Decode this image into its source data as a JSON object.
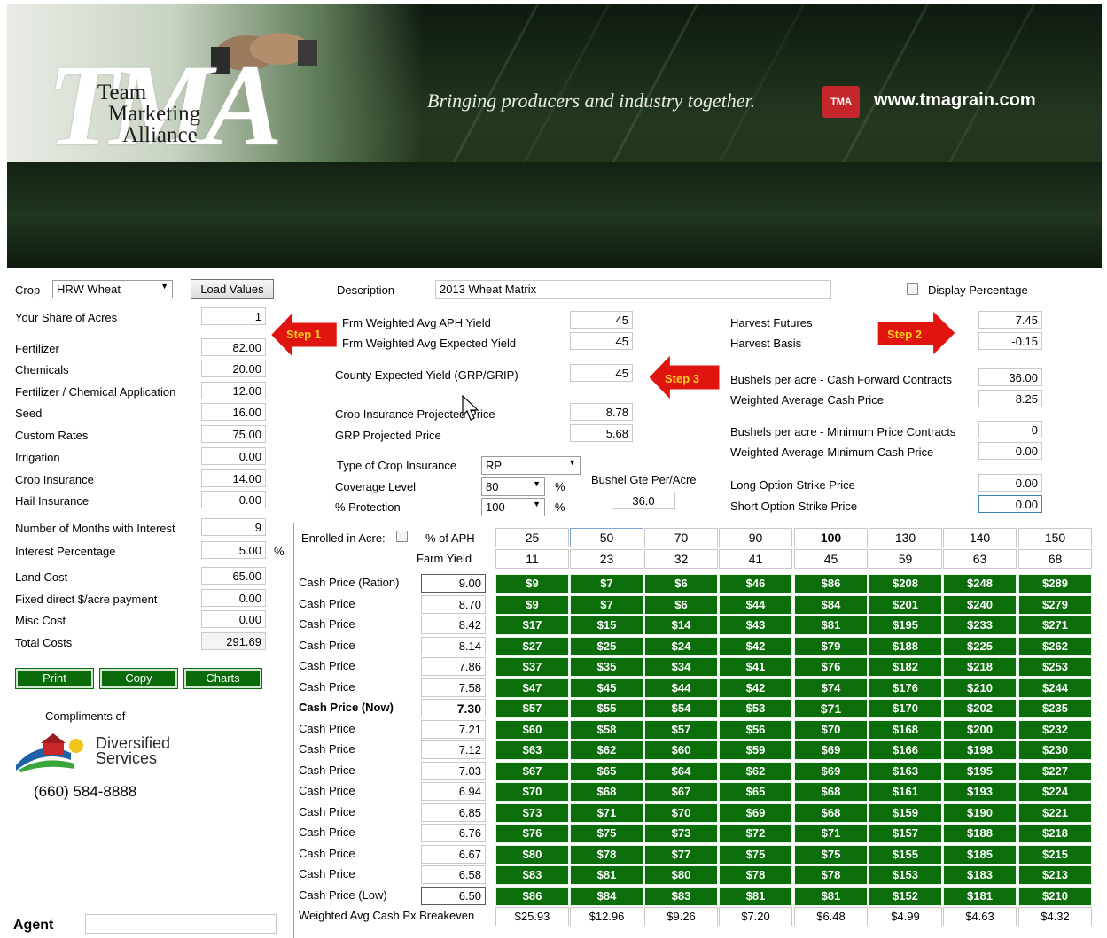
{
  "header": {
    "logo_letters": "TMA",
    "logo_words": [
      "Team",
      "Marketing",
      "Alliance"
    ],
    "tagline": "Bringing producers and industry together.",
    "badge": "TMA",
    "website": "www.tmagrain.com"
  },
  "left": {
    "crop_label": "Crop",
    "crop_value": "HRW Wheat",
    "load_values": "Load Values",
    "share_label": "Your Share of Acres",
    "share_value": "1",
    "costs": [
      {
        "label": "Fertilizer",
        "value": "82.00"
      },
      {
        "label": "Chemicals",
        "value": "20.00"
      },
      {
        "label": "Fertilizer / Chemical Application",
        "value": "12.00"
      },
      {
        "label": "Seed",
        "value": "16.00"
      },
      {
        "label": "Custom Rates",
        "value": "75.00"
      },
      {
        "label": "Irrigation",
        "value": "0.00"
      },
      {
        "label": "Crop Insurance",
        "value": "14.00"
      },
      {
        "label": "Hail Insurance",
        "value": "0.00"
      }
    ],
    "months_label": "Number of Months with Interest",
    "months_value": "9",
    "interest_label": "Interest Percentage",
    "interest_value": "5.00",
    "interest_unit": "%",
    "land_label": "Land Cost",
    "land_value": "65.00",
    "fixed_label": "Fixed direct $/acre payment",
    "fixed_value": "0.00",
    "misc_label": "Misc Cost",
    "misc_value": "0.00",
    "total_label": "Total Costs",
    "total_value": "291.69",
    "print": "Print",
    "copy": "Copy",
    "charts": "Charts",
    "compliments": "Compliments of",
    "sponsor_line1": "Diversified",
    "sponsor_line2": "Services",
    "phone": "(660) 584-8888",
    "agent_label": "Agent",
    "agent_value": ""
  },
  "middle": {
    "description_label": "Description",
    "description_value": "2013 Wheat  Matrix",
    "aph_label": "Frm Weighted Avg APH Yield",
    "aph_value": "45",
    "exp_label": "Frm Weighted Avg Expected Yield",
    "exp_value": "45",
    "county_label": "County Expected Yield (GRP/GRIP)",
    "county_value": "45",
    "proj_label": "Crop Insurance Projected Price",
    "proj_value": "8.78",
    "grp_label": "GRP Projected Price",
    "grp_value": "5.68",
    "type_label": "Type of Crop Insurance",
    "type_value": "RP",
    "coverage_label": "Coverage Level",
    "coverage_value": "80",
    "protection_label": "% Protection",
    "protection_value": "100",
    "pct": "%",
    "bushel_label": "Bushel Gte Per/Acre",
    "bushel_value": "36.0"
  },
  "right": {
    "display_pct": "Display Percentage",
    "futures_label": "Harvest Futures",
    "futures_value": "7.45",
    "basis_label": "Harvest Basis",
    "basis_value": "-0.15",
    "fwd_label": "Bushels per acre - Cash Forward Contracts",
    "fwd_value": "36.00",
    "wacp_label": "Weighted Average Cash Price",
    "wacp_value": "8.25",
    "min_label": "Bushels per acre - Minimum Price Contracts",
    "min_value": "0",
    "wamin_label": "Weighted Average Minimum Cash Price",
    "wamin_value": "0.00",
    "long_label": "Long Option Strike Price",
    "long_value": "0.00",
    "short_label": "Short Option Strike Price",
    "short_value": "0.00"
  },
  "steps": {
    "step1": "Step 1",
    "step2": "Step 2",
    "step3": "Step 3"
  },
  "colors": {
    "matrix_green": "#0b6e0b",
    "arrow_red": "#e0150f",
    "arrow_text": "#ffd21c"
  },
  "matrix": {
    "enrolled_label": "Enrolled in Acre:",
    "aph_label": "% of APH",
    "farm_yield_label": "Farm Yield",
    "aph_pcts": [
      "25",
      "50",
      "70",
      "90",
      "100",
      "130",
      "140",
      "150"
    ],
    "farm_yields": [
      "11",
      "23",
      "32",
      "41",
      "45",
      "59",
      "63",
      "68"
    ],
    "rows": [
      {
        "label": "Cash Price (Ration)",
        "price": "9.00",
        "cells": [
          "$9",
          "$7",
          "$6",
          "$46",
          "$86",
          "$208",
          "$248",
          "$289"
        ]
      },
      {
        "label": "Cash Price",
        "price": "8.70",
        "cells": [
          "$9",
          "$7",
          "$6",
          "$44",
          "$84",
          "$201",
          "$240",
          "$279"
        ]
      },
      {
        "label": "Cash Price",
        "price": "8.42",
        "cells": [
          "$17",
          "$15",
          "$14",
          "$43",
          "$81",
          "$195",
          "$233",
          "$271"
        ]
      },
      {
        "label": "Cash Price",
        "price": "8.14",
        "cells": [
          "$27",
          "$25",
          "$24",
          "$42",
          "$79",
          "$188",
          "$225",
          "$262"
        ]
      },
      {
        "label": "Cash Price",
        "price": "7.86",
        "cells": [
          "$37",
          "$35",
          "$34",
          "$41",
          "$76",
          "$182",
          "$218",
          "$253"
        ]
      },
      {
        "label": "Cash Price",
        "price": "7.58",
        "cells": [
          "$47",
          "$45",
          "$44",
          "$42",
          "$74",
          "$176",
          "$210",
          "$244"
        ]
      },
      {
        "label": "Cash Price (Now)",
        "price": "7.30",
        "cells": [
          "$57",
          "$55",
          "$54",
          "$53",
          "$71",
          "$170",
          "$202",
          "$235"
        ]
      },
      {
        "label": "Cash Price",
        "price": "7.21",
        "cells": [
          "$60",
          "$58",
          "$57",
          "$56",
          "$70",
          "$168",
          "$200",
          "$232"
        ]
      },
      {
        "label": "Cash Price",
        "price": "7.12",
        "cells": [
          "$63",
          "$62",
          "$60",
          "$59",
          "$69",
          "$166",
          "$198",
          "$230"
        ]
      },
      {
        "label": "Cash Price",
        "price": "7.03",
        "cells": [
          "$67",
          "$65",
          "$64",
          "$62",
          "$69",
          "$163",
          "$195",
          "$227"
        ]
      },
      {
        "label": "Cash Price",
        "price": "6.94",
        "cells": [
          "$70",
          "$68",
          "$67",
          "$65",
          "$68",
          "$161",
          "$193",
          "$224"
        ]
      },
      {
        "label": "Cash Price",
        "price": "6.85",
        "cells": [
          "$73",
          "$71",
          "$70",
          "$69",
          "$68",
          "$159",
          "$190",
          "$221"
        ]
      },
      {
        "label": "Cash Price",
        "price": "6.76",
        "cells": [
          "$76",
          "$75",
          "$73",
          "$72",
          "$71",
          "$157",
          "$188",
          "$218"
        ]
      },
      {
        "label": "Cash Price",
        "price": "6.67",
        "cells": [
          "$80",
          "$78",
          "$77",
          "$75",
          "$75",
          "$155",
          "$185",
          "$215"
        ]
      },
      {
        "label": "Cash Price",
        "price": "6.58",
        "cells": [
          "$83",
          "$81",
          "$80",
          "$78",
          "$78",
          "$153",
          "$183",
          "$213"
        ]
      },
      {
        "label": "Cash Price (Low)",
        "price": "6.50",
        "cells": [
          "$86",
          "$84",
          "$83",
          "$81",
          "$81",
          "$152",
          "$181",
          "$210"
        ]
      }
    ],
    "breakeven_label": "Weighted Avg Cash Px Breakeven",
    "breakeven": [
      "$25.93",
      "$12.96",
      "$9.26",
      "$7.20",
      "$6.48",
      "$4.99",
      "$4.63",
      "$4.32"
    ]
  }
}
